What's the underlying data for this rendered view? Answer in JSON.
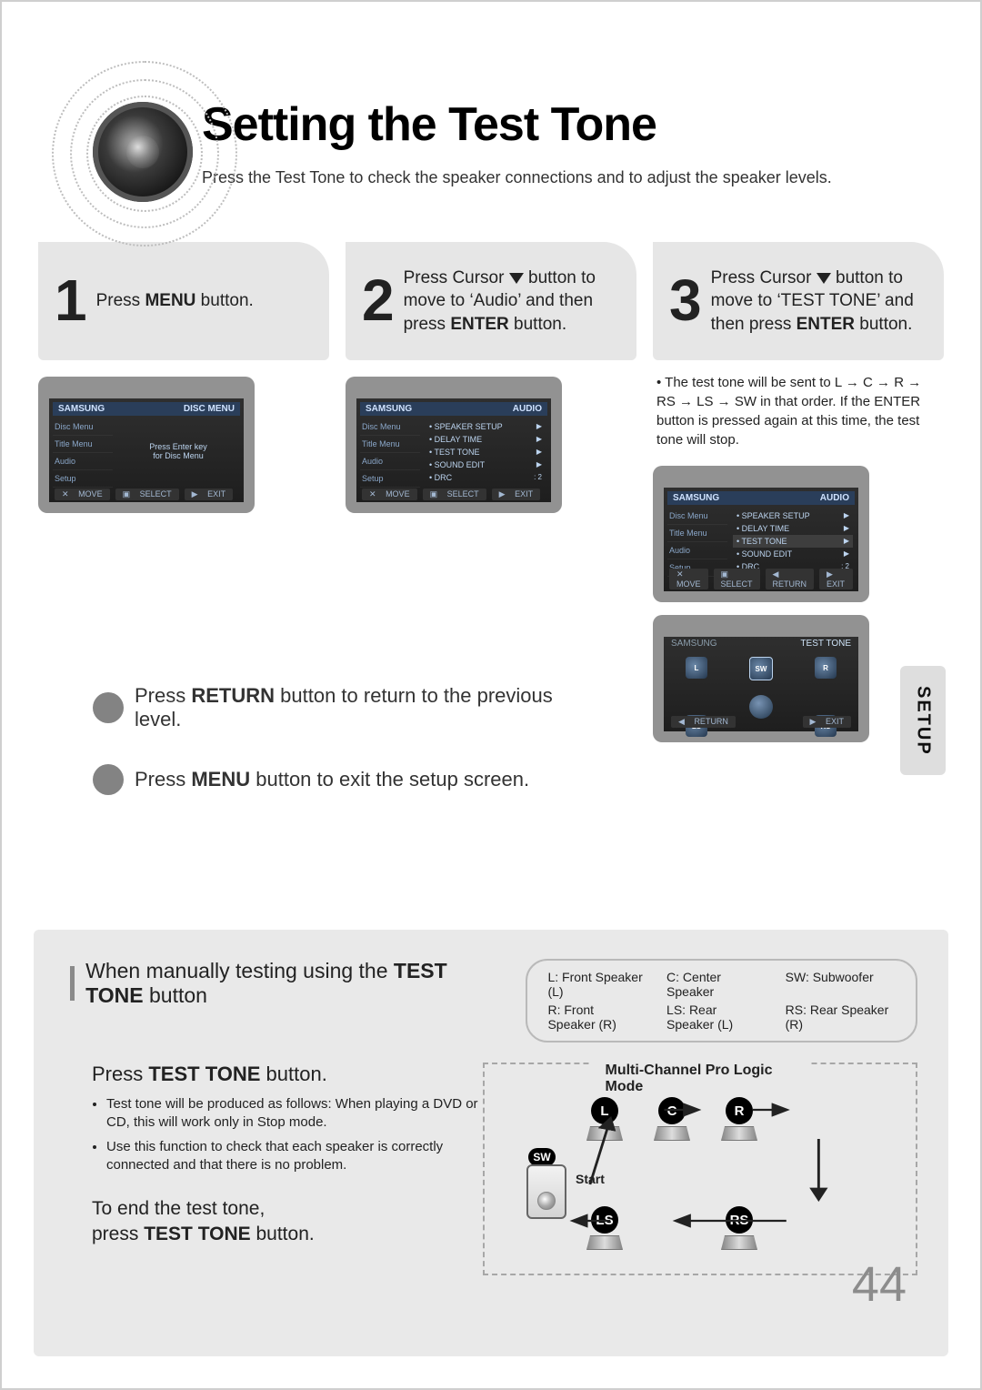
{
  "title": "Setting the Test Tone",
  "intro": "Press the Test Tone to check the speaker connections and to adjust the speaker levels.",
  "sidebar_tab": "SETUP",
  "page_number": "44",
  "steps": {
    "s1": {
      "num": "1",
      "text_pre": "Press ",
      "bold": "MENU",
      "text_post": " button."
    },
    "s2": {
      "num": "2",
      "line1a": "Press Cursor ",
      "line2": "button to move to ‘Audio’ and then press ",
      "bold": "ENTER",
      "line3": " button."
    },
    "s3": {
      "num": "3",
      "line1a": "Press Cursor ",
      "line2": "button to move to ‘TEST TONE’ and then press ",
      "bold": "ENTER",
      "line3": " button."
    }
  },
  "step3_note": {
    "bullet": "• ",
    "body": "The test tone will be sent to L → C → R → RS → LS → SW in that order. If the ENTER button is pressed again at this time, the test tone will stop."
  },
  "osd_common": {
    "side": [
      "Disc Menu",
      "Title Menu",
      "Audio",
      "Setup"
    ],
    "footer_move": "MOVE",
    "footer_select": "SELECT",
    "footer_return": "RETURN",
    "footer_exit": "EXIT"
  },
  "osd1": {
    "hdr_left": "SAMSUNG",
    "hdr_right": "DISC MENU",
    "body_line1": "Press Enter key",
    "body_line2": "for Disc Menu"
  },
  "osd2": {
    "hdr_left": "SAMSUNG",
    "hdr_right": "AUDIO",
    "rows": [
      {
        "label": "SPEAKER SETUP",
        "val": "▶"
      },
      {
        "label": "DELAY TIME",
        "val": "▶"
      },
      {
        "label": "TEST TONE",
        "val": "▶"
      },
      {
        "label": "SOUND EDIT",
        "val": "▶"
      },
      {
        "label": "DRC",
        "val": ": 2"
      }
    ],
    "selected": -1
  },
  "osd3": {
    "hdr_left": "SAMSUNG",
    "hdr_right": "AUDIO",
    "rows": [
      {
        "label": "SPEAKER SETUP",
        "val": "▶"
      },
      {
        "label": "DELAY TIME",
        "val": "▶"
      },
      {
        "label": "TEST TONE",
        "val": "▶"
      },
      {
        "label": "SOUND EDIT",
        "val": "▶"
      },
      {
        "label": "DRC",
        "val": ": 2"
      }
    ],
    "selected": 2
  },
  "osd4": {
    "hdr_left": "SAMSUNG",
    "hdr_right": "TEST TONE",
    "spk": {
      "L": "L",
      "C": "SW",
      "R": "R",
      "LS": "LS",
      "RS": "RS"
    }
  },
  "hints": {
    "h1_pre": "Press ",
    "h1_bold": "RETURN",
    "h1_post": " button to return to the previous level.",
    "h2_pre": "Press ",
    "h2_bold": "MENU",
    "h2_post": " button to exit the setup screen."
  },
  "lower": {
    "title_pre": "When manually testing using the ",
    "title_bold": "TEST TONE",
    "title_post": " button",
    "legend": [
      "L: Front Speaker (L)",
      "C: Center Speaker",
      "SW: Subwoofer",
      "R: Front Speaker (R)",
      "LS: Rear Speaker (L)",
      "RS: Rear Speaker (R)"
    ],
    "sub_pre": "Press ",
    "sub_bold": "TEST TONE",
    "sub_post": " button.",
    "bullets": [
      "Test tone will be produced as follows: When playing a DVD or CD, this will work only in Stop mode.",
      "Use this function to check that each speaker is correctly connected and that there is no problem."
    ],
    "end_line1": "To end the test tone,",
    "end_line2_pre": "press ",
    "end_line2_bold": "TEST TONE",
    "end_line2_post": " button.",
    "diagram_caption": "Multi-Channel Pro Logic Mode",
    "diagram_start": "Start",
    "sw_label": "SW",
    "nodes": {
      "L": "L",
      "C": "C",
      "R": "R",
      "LS": "LS",
      "RS": "RS"
    }
  }
}
